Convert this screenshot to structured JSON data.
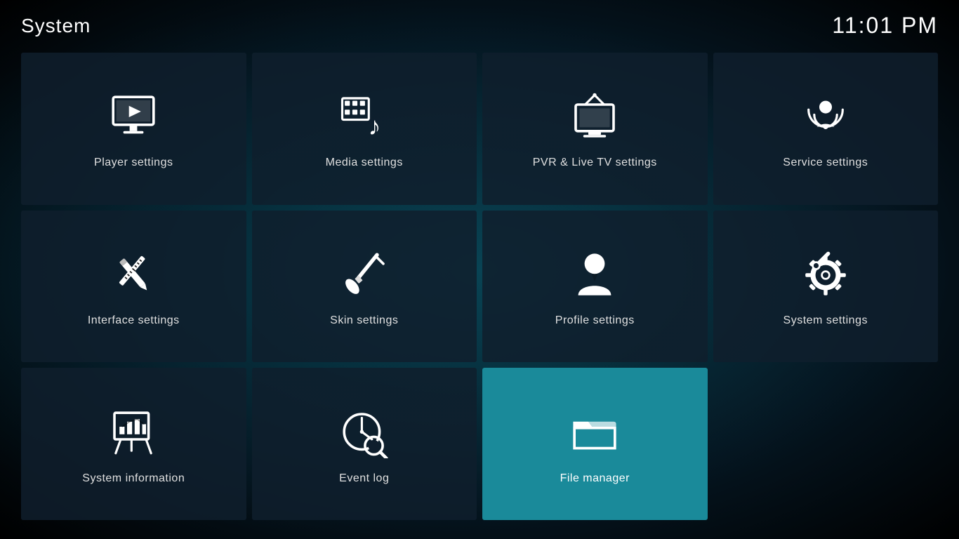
{
  "header": {
    "title": "System",
    "clock": "11:01 PM"
  },
  "tiles": [
    {
      "id": "player-settings",
      "label": "Player settings",
      "icon": "player",
      "active": false
    },
    {
      "id": "media-settings",
      "label": "Media settings",
      "icon": "media",
      "active": false
    },
    {
      "id": "pvr-settings",
      "label": "PVR & Live TV settings",
      "icon": "pvr",
      "active": false
    },
    {
      "id": "service-settings",
      "label": "Service settings",
      "icon": "service",
      "active": false
    },
    {
      "id": "interface-settings",
      "label": "Interface settings",
      "icon": "interface",
      "active": false
    },
    {
      "id": "skin-settings",
      "label": "Skin settings",
      "icon": "skin",
      "active": false
    },
    {
      "id": "profile-settings",
      "label": "Profile settings",
      "icon": "profile",
      "active": false
    },
    {
      "id": "system-settings",
      "label": "System settings",
      "icon": "system",
      "active": false
    },
    {
      "id": "system-information",
      "label": "System information",
      "icon": "sysinfo",
      "active": false
    },
    {
      "id": "event-log",
      "label": "Event log",
      "icon": "eventlog",
      "active": false
    },
    {
      "id": "file-manager",
      "label": "File manager",
      "icon": "filemanager",
      "active": true
    }
  ]
}
